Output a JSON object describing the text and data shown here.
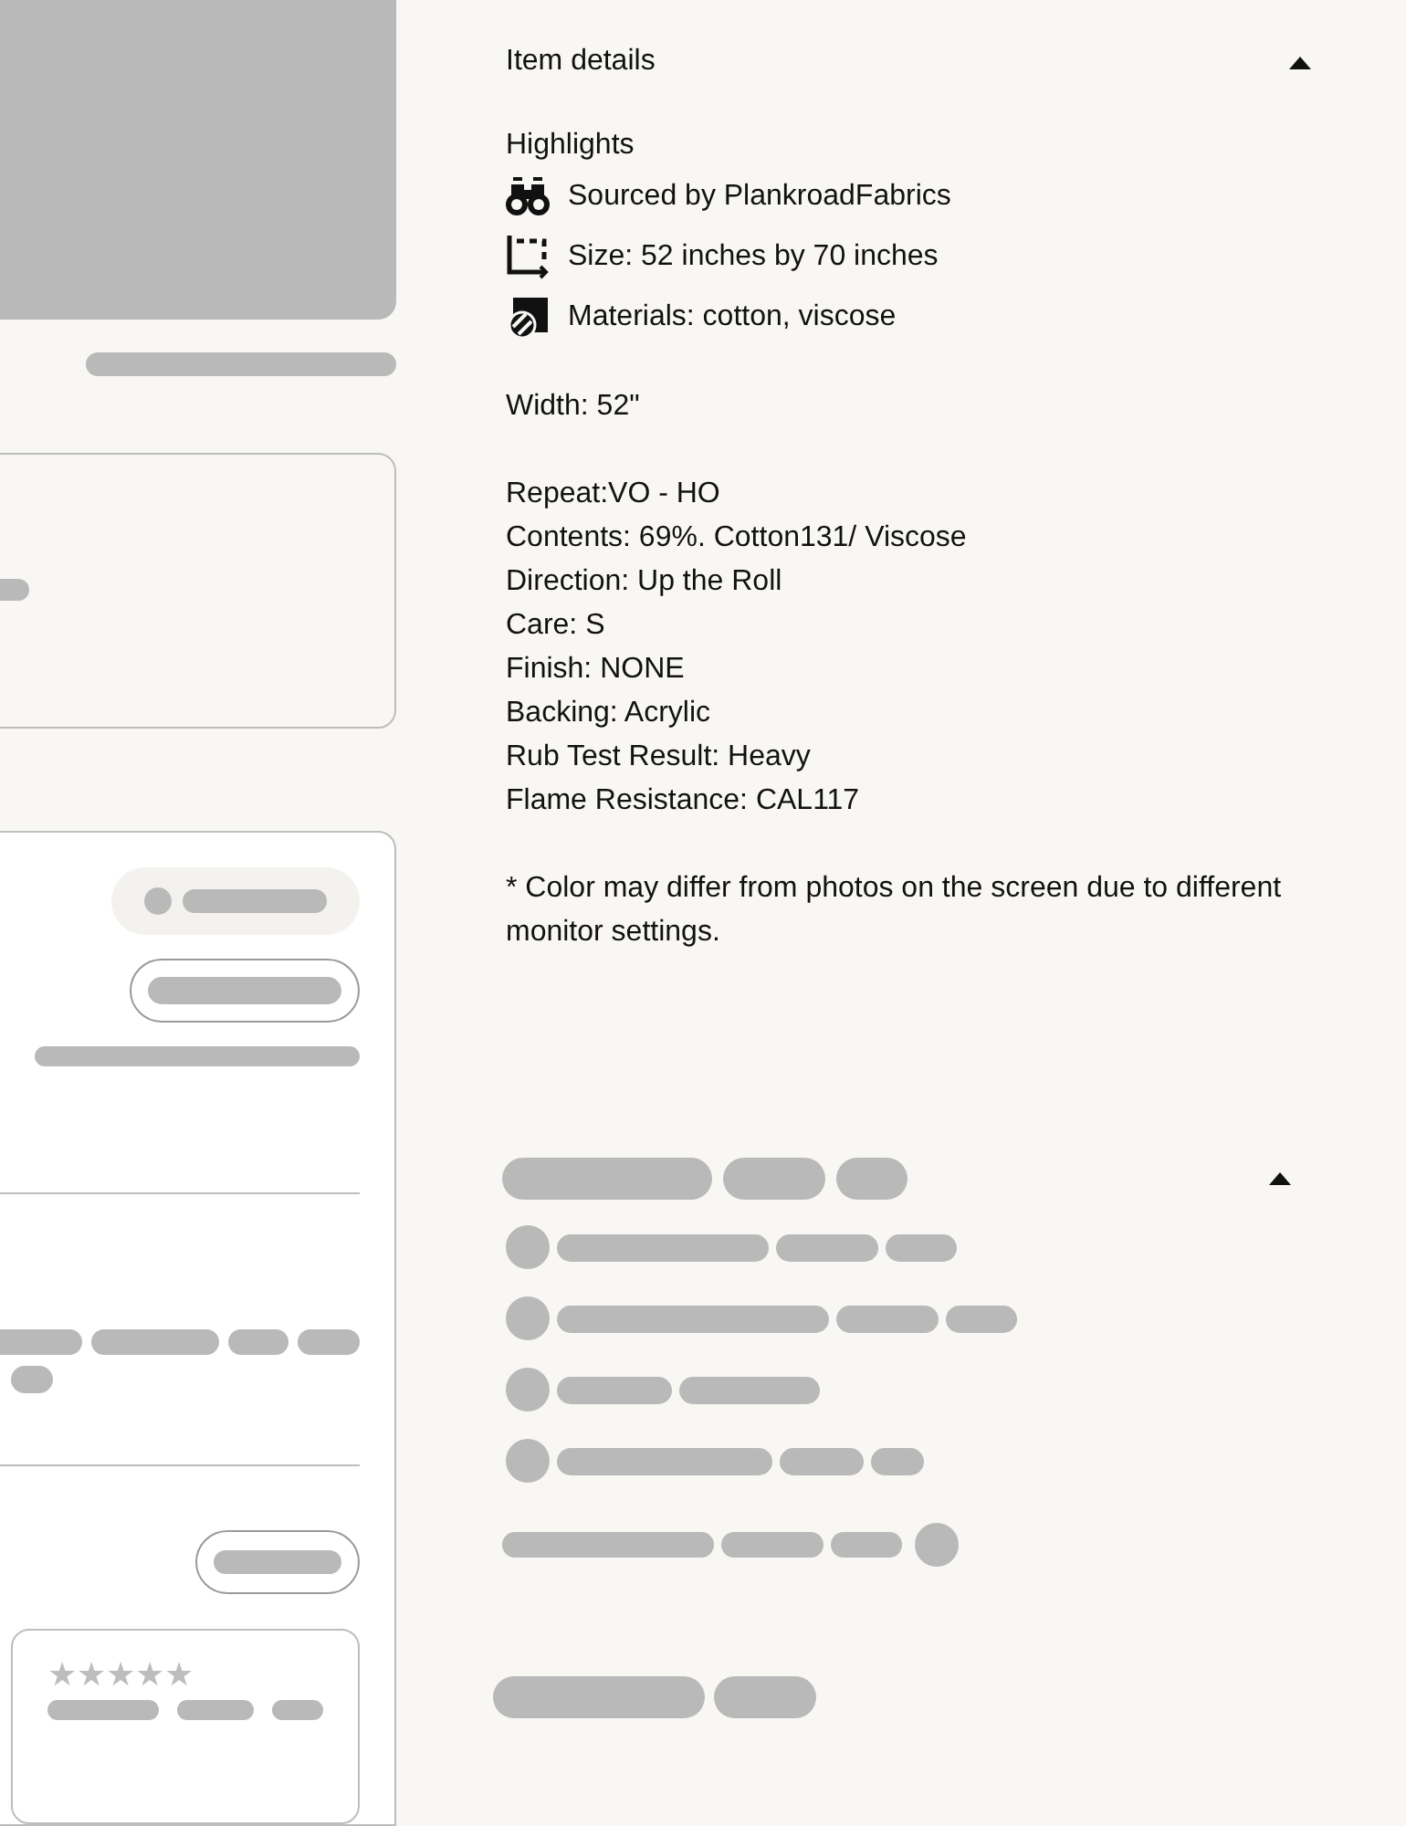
{
  "item_details": {
    "title": "Item details",
    "expanded": true,
    "highlights_heading": "Highlights",
    "highlights": [
      {
        "kind": "source",
        "text": "Sourced by PlankroadFabrics"
      },
      {
        "kind": "size",
        "text": "Size: 52 inches by 70 inches"
      },
      {
        "kind": "materials",
        "text": "Materials: cotton, viscose"
      }
    ],
    "paragraphs": [
      [
        "Width: 52\""
      ],
      [
        "Repeat:VO - HO",
        "Contents: 69%. Cotton131/ Viscose",
        "Direction: Up the Roll",
        "Care: S",
        "Finish: NONE",
        "Backing: Acrylic",
        "Rub Test Result: Heavy",
        "Flame Resistance: CAL117"
      ],
      [
        "* Color may differ from photos on the screen due to different monitor settings."
      ]
    ]
  },
  "second_section": {
    "expanded": true
  },
  "review_card": {
    "stars_text": "★★★★★"
  }
}
